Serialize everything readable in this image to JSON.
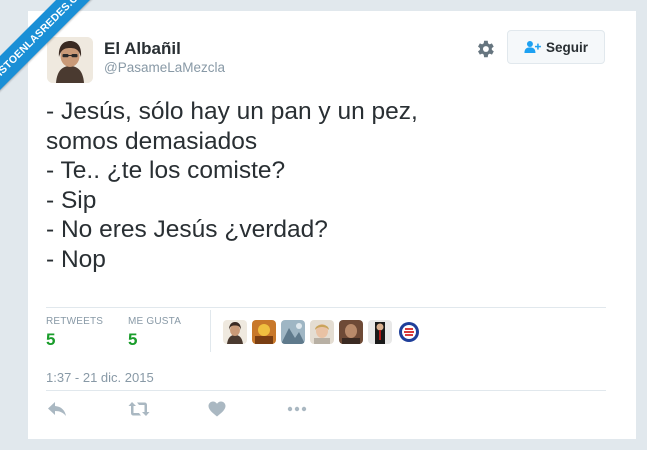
{
  "watermark": {
    "text": "VISTOENLASREDES.COM"
  },
  "user": {
    "name": "El Albañil",
    "handle": "@PasameLaMezcla",
    "avatar_icon": "user-avatar"
  },
  "header": {
    "follow_label": "Seguir",
    "gear_icon": "gear-icon",
    "follow_icon": "add-user-icon"
  },
  "tweet": {
    "lines": [
      "- Jesús, sólo hay un pan y un pez,",
      "somos demasiados",
      "- Te.. ¿te los comiste?",
      "- Sip",
      "- No eres Jesús ¿verdad?",
      "- Nop"
    ]
  },
  "stats": {
    "retweets_label": "RETWEETS",
    "retweets_value": "5",
    "likes_label": "ME GUSTA",
    "likes_value": "5"
  },
  "timestamp": "1:37 - 21 dic. 2015",
  "actions": [
    "reply-icon",
    "retweet-icon",
    "heart-icon",
    "more-icon"
  ],
  "colors": {
    "count_green": "#1a9d2b",
    "muted": "#8899a6",
    "banner_blue": "#1a8fd6",
    "text": "#292f33"
  }
}
